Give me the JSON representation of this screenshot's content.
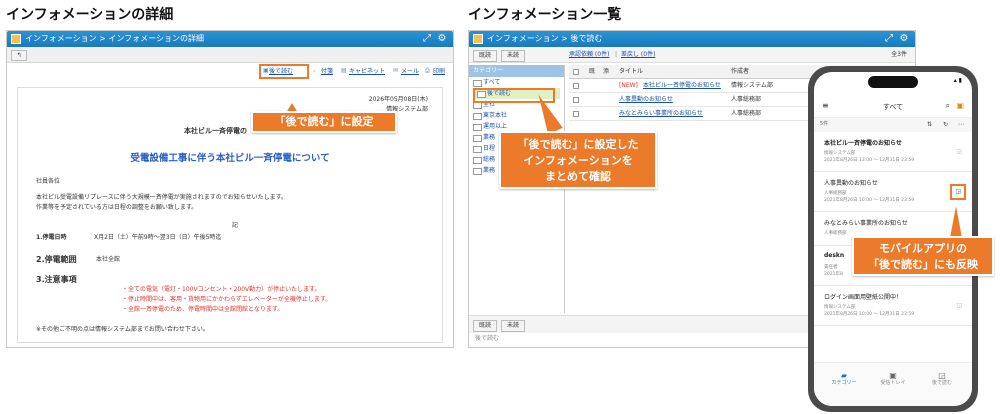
{
  "left": {
    "heading": "インフォメーションの詳細",
    "window_title": "インフォメーション > インフォメーションの詳細",
    "toolbar": {
      "read_later": "後で読む",
      "attach": "付箋",
      "cabinet": "キャビネット",
      "mail": "メール",
      "print": "印刷"
    },
    "doc": {
      "date": "2026年05月08日(木)",
      "dept": "情報システム部",
      "org": "本社ビル一斉停電の",
      "title": "受電設備工事に伴う本社ビル一斉停電について",
      "to": "社員各位",
      "body1": "本社ビル受電設備リプレースに伴う大規模一斉停電が実施されますのでお知らせいたします。",
      "body2": "作業等を予定されている方は日程の調整をお願い致します。",
      "ki": "記",
      "s1_label": "1.停電日時",
      "s1_value": "X月2日（土）午前9時～翌3日（日）午後5時迄",
      "s2_label": "2.停電範囲",
      "s2_value": "本社全館",
      "s3_label": "3.注意事項",
      "note1": "・全ての電気（電灯・100Vコンセント・200V動力）が停止いたします。",
      "note2": "・停止時間中は、客用・貨物用にかかわらずエレベーターが全機停止します。",
      "note3": "・全館一斉停電のため、停電時間中は全館閉館となります。",
      "footer": "※その他ご不明の点は情報システム部までお問い合わせ下さい。"
    },
    "callout": "「後で読む」に設定"
  },
  "mid": {
    "heading": "インフォメーション一覧",
    "window_title": "インフォメーション > 後で読む",
    "btn_read": "既読",
    "btn_unread": "未読",
    "tab_pending": "承認依頼 (0件)",
    "tab_sent": "差戻し (0件)",
    "count": "全3件",
    "category_header": "カテゴリー",
    "categories": [
      "すべて",
      "後で読む",
      "全社",
      "東京本社",
      "運用以上",
      "業務",
      "日程",
      "総務",
      "業務"
    ],
    "col_title": "タイトル",
    "col_author": "作成者",
    "col_read": "既",
    "col_attach": "添",
    "rows": [
      {
        "new": "[NEW]",
        "title": "本社ビル一斉停電のお知らせ",
        "author": "情報システム部"
      },
      {
        "new": "",
        "title": "人事異動のお知らせ",
        "author": "人事総務部"
      },
      {
        "new": "",
        "title": "みなとみらい事業所のお知らせ",
        "author": "人事総務部"
      }
    ],
    "footer_label": "後で読む",
    "callout_line1": "「後で読む」に設定した",
    "callout_line2": "インフォメーションを",
    "callout_line3": "まとめて確認"
  },
  "phone": {
    "header_title": "すべて",
    "count": "5件",
    "items": [
      {
        "title": "本社ビル一斉停電のお知らせ",
        "sub1": "情報システム部",
        "sub2": "2021年8月26日 13:00 ～ 12月31日 23:59"
      },
      {
        "title": "人事異動のお知らせ",
        "sub1": "人事総務部",
        "sub2": "2021年8月26日 10:00 ～ 12月31日 23:59"
      },
      {
        "title": "みなとみらい事業所のお知らせ",
        "sub1": "人事総務部",
        "sub2": ""
      },
      {
        "title": "deskn",
        "sub1": "責任者",
        "sub2": "2021年8"
      },
      {
        "title": "ログイン画面用壁紙公開中！",
        "sub1": "情報システム部",
        "sub2": "2021年8月26日 10:00 ～ 12月31日 23:59"
      }
    ],
    "nav": [
      "カテゴリー",
      "受信トレイ",
      "後で読む"
    ],
    "callout_line1": "モバイルアプリの",
    "callout_line2": "「後で読む」にも反映"
  },
  "colors": {
    "titlebar": "#1a79bf",
    "callout": "#ec7a2b",
    "link": "#1a4fa8",
    "new_red": "#e8332c"
  }
}
